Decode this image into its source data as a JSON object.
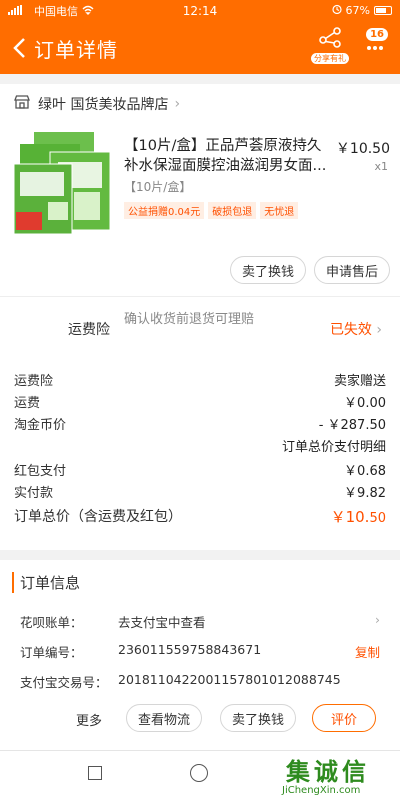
{
  "status": {
    "carrier": "中国电信",
    "time": "12:14",
    "battery": "67%"
  },
  "header": {
    "title": "订单详情",
    "share_tag": "分享有礼",
    "msg_badge": "16"
  },
  "shop": {
    "name": "绿叶 国货美妆品牌店"
  },
  "product": {
    "title": "【10片/盒】正品芦荟原液持久补水保湿面膜控油滋润男女面...",
    "spec": "【10片/盒】",
    "price": "￥10.50",
    "qty": "x1",
    "tags": [
      "公益捐赠0.04元",
      "破损包退",
      "无忧退"
    ]
  },
  "actions1": {
    "return": "卖了换钱",
    "aftersale": "申请售后"
  },
  "insurance": {
    "label": "运费险",
    "desc": "确认收货前退货可理赔",
    "status": "已失效"
  },
  "fees": {
    "freight_ins_label": "运费险",
    "freight_ins_value": "卖家赠送",
    "shipping_label": "运费",
    "shipping_value": "￥0.00",
    "taojin_label": "淘金币价",
    "taojin_value": "- ￥287.50",
    "breakdown": "订单总价支付明细",
    "redpack_label": "红包支付",
    "redpack_value": "￥0.68",
    "paid_label": "实付款",
    "paid_value": "￥9.82",
    "total_label": "订单总价（含运费及红包）",
    "total_value": "￥10.",
    "total_value_small": "50"
  },
  "order_info": {
    "title": "订单信息",
    "huabei_label": "花呗账单：",
    "huabei_value": "去支付宝中查看",
    "order_no_label": "订单编号：",
    "order_no_value": "2360115597588436​71",
    "copy": "复制",
    "alipay_label": "支付宝交易号：",
    "alipay_value": "2018110422001157801012088745"
  },
  "actions2": {
    "more": "更多",
    "logistics": "查看物流",
    "return": "卖了换钱",
    "review": "评价"
  },
  "watermark": {
    "big": "集诚信",
    "url": "JiChengXin.com"
  }
}
